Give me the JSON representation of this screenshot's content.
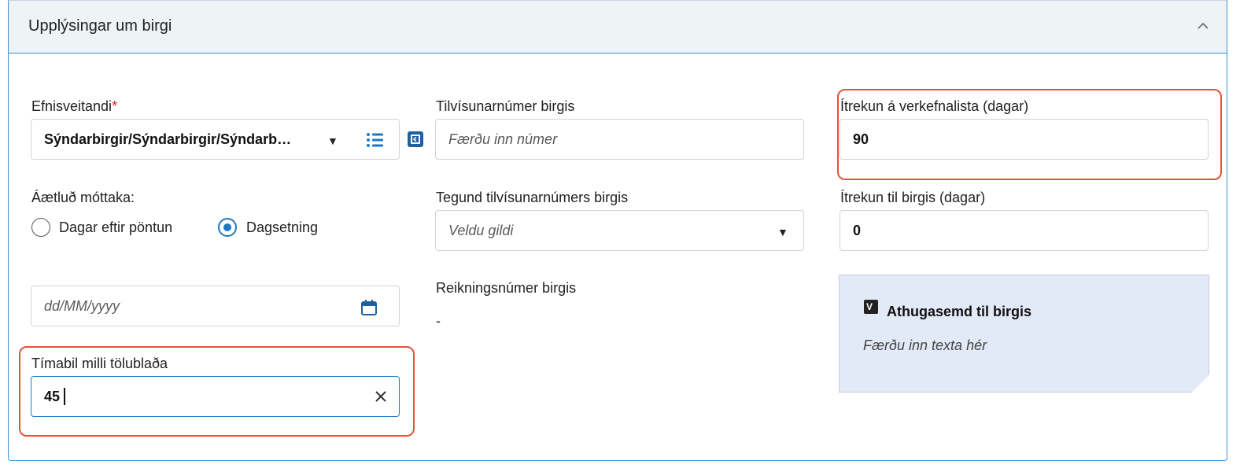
{
  "panel": {
    "title": "Upplýsingar um birgi"
  },
  "supplier": {
    "label": "Efnisveitandi",
    "required_mark": "*",
    "value": "Sýndarbirgir/Sýndarbirgir/Sýndarb…"
  },
  "reference_number": {
    "label": "Tilvísunarnúmer birgis",
    "placeholder": "Færðu inn númer"
  },
  "reminder_tasklist": {
    "label": "Ítrekun á verkefnalista (dagar)",
    "value": "90"
  },
  "expected_receipt": {
    "label": "Áætluð móttaka:",
    "options": [
      {
        "label": "Dagar eftir pöntun",
        "checked": false
      },
      {
        "label": "Dagsetning",
        "checked": true
      }
    ]
  },
  "reference_type": {
    "label": "Tegund tilvísunarnúmers birgis",
    "placeholder": "Veldu gildi"
  },
  "reminder_supplier": {
    "label": "Ítrekun til birgis (dagar)",
    "value": "0"
  },
  "date_field": {
    "placeholder": "dd/MM/yyyy"
  },
  "account_number": {
    "label": "Reikningsnúmer birgis",
    "value": "-"
  },
  "note": {
    "title": "Athugasemd til birgis",
    "placeholder": "Færðu inn texta hér"
  },
  "issue_interval": {
    "label": "Tímabil milli tölublaða",
    "value": "45"
  },
  "colors": {
    "accent": "#1f78c4",
    "highlight": "#e0533c",
    "note_bg": "#e2e9f7",
    "required": "#e02020"
  }
}
